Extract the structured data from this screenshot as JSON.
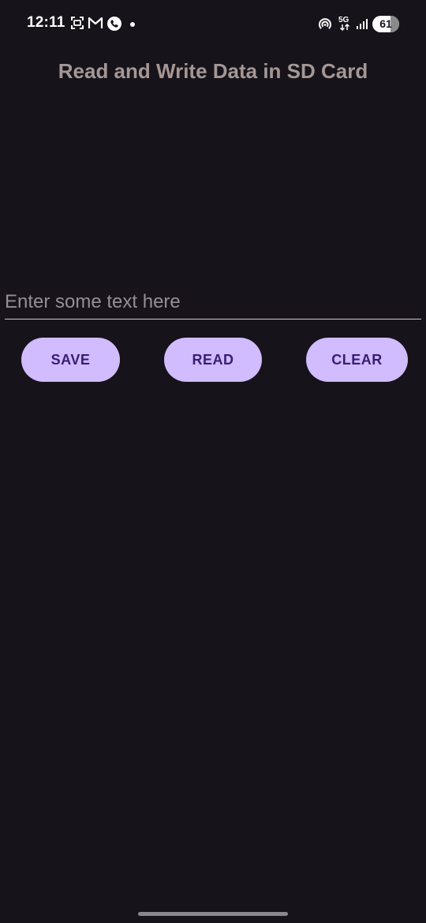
{
  "status_bar": {
    "time": "12:11",
    "icons": [
      "screenshot-icon",
      "gmail-icon",
      "phone-call-icon",
      "notification-dot-icon",
      "hotspot-icon",
      "5g-icon",
      "signal-icon"
    ],
    "network": "5G",
    "battery": "61"
  },
  "app": {
    "title": "Read and Write Data in SD Card"
  },
  "input": {
    "placeholder": "Enter some text here",
    "value": ""
  },
  "buttons": {
    "save": "SAVE",
    "read": "READ",
    "clear": "CLEAR"
  },
  "colors": {
    "background": "#16131a",
    "title": "#a49795",
    "button_fill": "#d0bcff",
    "button_text": "#381e72"
  }
}
